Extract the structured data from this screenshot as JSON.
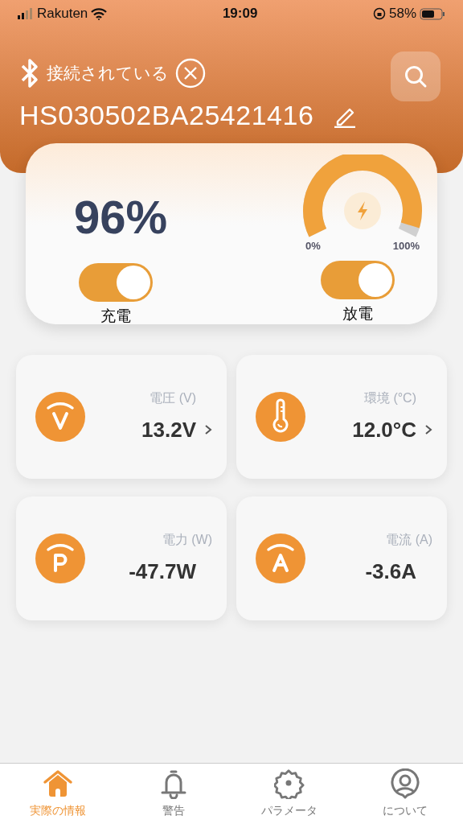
{
  "status_bar": {
    "carrier": "Rakuten",
    "time": "19:09",
    "battery": "58%"
  },
  "header": {
    "connection": "接続されている",
    "device_name": "HS030502BA25421416"
  },
  "battery_card": {
    "percent": "96%",
    "gauge": {
      "min_label": "0%",
      "max_label": "100%"
    },
    "switches": [
      {
        "label": "充電",
        "on": true
      },
      {
        "label": "放電",
        "on": true
      }
    ]
  },
  "tiles": [
    {
      "kind": "voltage",
      "label": "電圧 (V)",
      "value": "13.2V",
      "chevron": true
    },
    {
      "kind": "temperature",
      "label": "環境 (°C)",
      "value": "12.0°C",
      "chevron": true
    },
    {
      "kind": "power",
      "label": "電力 (W)",
      "value": "-47.7W",
      "chevron": false
    },
    {
      "kind": "current",
      "label": "電流 (A)",
      "value": "-3.6A",
      "chevron": false
    }
  ],
  "tab_bar": [
    {
      "kind": "home",
      "label": "実際の情報",
      "selected": true
    },
    {
      "kind": "bell",
      "label": "警告",
      "selected": false
    },
    {
      "kind": "gear",
      "label": "パラメータ",
      "selected": false
    },
    {
      "kind": "person",
      "label": "について",
      "selected": false
    }
  ]
}
